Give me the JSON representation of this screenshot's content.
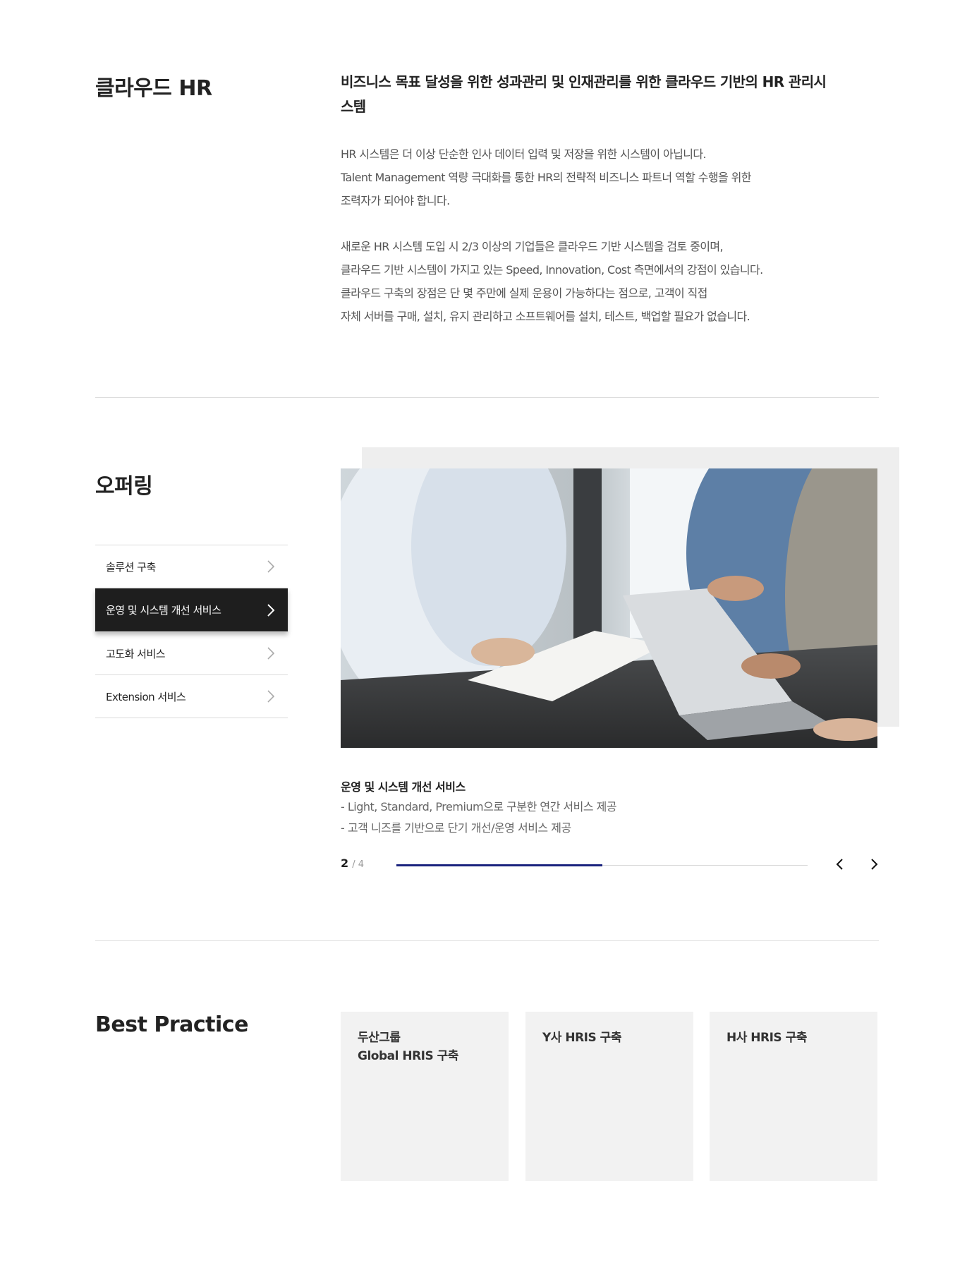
{
  "cloud_hr": {
    "title": "클라우드 HR",
    "lead": "비즈니스 목표 달성을 위한 성과관리 및 인재관리를 위한 클라우드 기반의 HR 관리시스템",
    "paragraph1": [
      "HR 시스템은 더 이상 단순한 인사 데이터 입력 및 저장을 위한 시스템이 아닙니다.",
      "Talent Management 역량 극대화를 통한 HR의 전략적 비즈니스 파트너 역할 수행을 위한",
      "조력자가 되어야 합니다."
    ],
    "paragraph2": [
      "새로운 HR 시스템 도입 시 2/3 이상의 기업들은 클라우드 기반 시스템을 검토 중이며,",
      "클라우드 기반 시스템이 가지고 있는 Speed, Innovation, Cost 측면에서의 강점이 있습니다.",
      "클라우드 구축의 장점은 단 몇 주만에 실제 운용이 가능하다는 점으로, 고객이 직접",
      "자체 서버를 구매, 설치, 유지 관리하고 소프트웨어를 설치, 테스트, 백업할 필요가 없습니다."
    ]
  },
  "offering": {
    "title": "오퍼링",
    "menu": [
      {
        "label": "솔루션 구축",
        "active": false
      },
      {
        "label": "운영 및 시스템 개선 서비스",
        "active": true
      },
      {
        "label": "고도화 서비스",
        "active": false
      },
      {
        "label": "Extension 서비스",
        "active": false
      }
    ],
    "caption_title": "운영 및 시스템 개선 서비스",
    "caption_lines": [
      "-  Light, Standard, Premium으로 구분한 연간 서비스 제공",
      "-  고객 니즈를 기반으로 단기 개선/운영 서비스 제공"
    ],
    "pager_current": "2",
    "pager_total": "/ 4",
    "progress": 0.5
  },
  "best_practice": {
    "title": "Best Practice",
    "cards": [
      {
        "title": "두산그룹\nGlobal HRIS 구축"
      },
      {
        "title": "Y사 HRIS 구축"
      },
      {
        "title": "H사 HRIS 구축"
      }
    ]
  },
  "colors": {
    "accent": "#1a237e",
    "active_menu_bg": "#1e1e1e",
    "card_bg": "#f2f2f2"
  }
}
